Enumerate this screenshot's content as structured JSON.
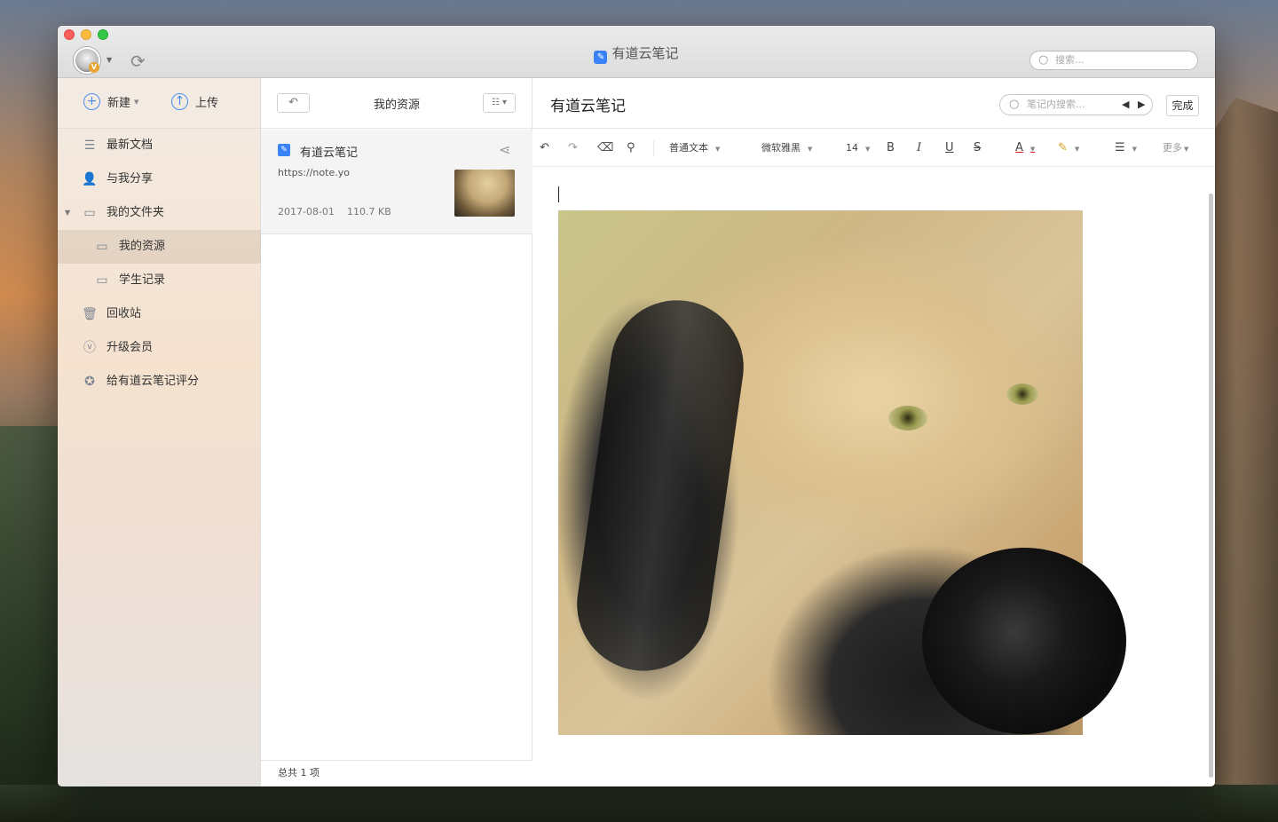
{
  "window": {
    "title": "有道云笔记",
    "avatar_badge": "V",
    "global_search_placeholder": "搜索..."
  },
  "sidebar": {
    "new_label": "新建",
    "upload_label": "上传",
    "items": [
      {
        "label": "最新文档",
        "icon": "layers-icon"
      },
      {
        "label": "与我分享",
        "icon": "people-icon"
      },
      {
        "label": "我的文件夹",
        "icon": "folder-open-icon"
      },
      {
        "label": "我的资源",
        "icon": "folder-icon"
      },
      {
        "label": "学生记录",
        "icon": "folder-icon"
      },
      {
        "label": "回收站",
        "icon": "trash-icon"
      },
      {
        "label": "升级会员",
        "icon": "vip-icon"
      },
      {
        "label": "给有道云笔记评分",
        "icon": "star-badge-icon"
      }
    ]
  },
  "list": {
    "title": "我的资源",
    "note": {
      "title": "有道云笔记",
      "url": "https://note.yo",
      "date": "2017-08-01",
      "size": "110.7 KB"
    },
    "footer": "总共 1 项"
  },
  "editor": {
    "title": "有道云笔记",
    "in_note_search_placeholder": "笔记内搜索...",
    "done_label": "完成",
    "toolbar": {
      "paragraph_style": "普通文本",
      "font_family": "微软雅黑",
      "font_size": "14",
      "bold": "B",
      "italic": "I",
      "underline": "U",
      "strike": "S",
      "text_color": "A",
      "more": "更多"
    }
  },
  "colors": {
    "accent": "#3a82f7"
  }
}
